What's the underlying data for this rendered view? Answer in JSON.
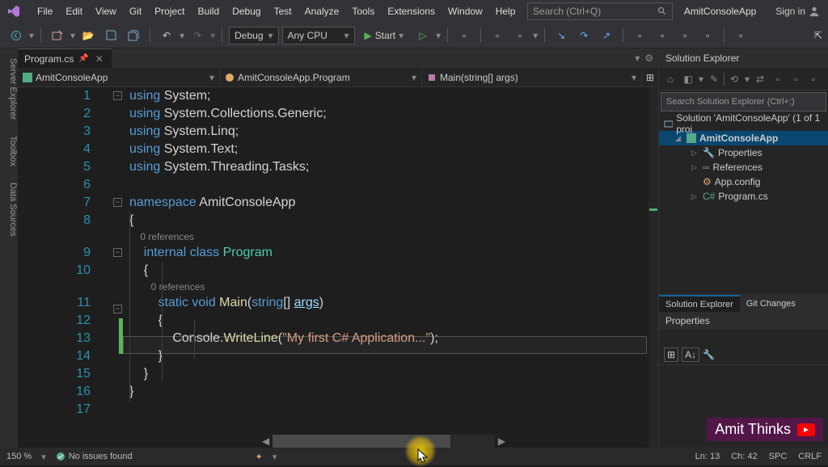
{
  "menubar": [
    "File",
    "Edit",
    "View",
    "Git",
    "Project",
    "Build",
    "Debug",
    "Test",
    "Analyze",
    "Tools",
    "Extensions",
    "Window",
    "Help"
  ],
  "search_placeholder": "Search (Ctrl+Q)",
  "app_title": "AmitConsoleApp",
  "signin": "Sign in",
  "toolbar": {
    "config": "Debug",
    "platform": "Any CPU",
    "start": "Start"
  },
  "tab": {
    "name": "Program.cs"
  },
  "navbar": {
    "project": "AmitConsoleApp",
    "class": "AmitConsoleApp.Program",
    "member": "Main(string[] args)"
  },
  "code": {
    "l1": "using System;",
    "l2": "using System.Collections.Generic;",
    "l3": "using System.Linq;",
    "l4": "using System.Text;",
    "l5": "using System.Threading.Tasks;",
    "ref1": "0 references",
    "ref2": "0 references",
    "l7a": "namespace",
    "l7b": "AmitConsoleApp",
    "l9a": "internal",
    "l9b": "class",
    "l9c": "Program",
    "l11a": "static",
    "l11b": "void",
    "l11c": "Main",
    "l11d": "string",
    "l11e": "args",
    "l13a": "Console",
    "l13b": ".",
    "l13c": "WriteLine",
    "l13d": "\"My first C# Application...\""
  },
  "lines": [
    "1",
    "2",
    "3",
    "4",
    "5",
    "6",
    "7",
    "8",
    "",
    "9",
    "10",
    "",
    "11",
    "12",
    "13",
    "14",
    "15",
    "16",
    "17"
  ],
  "solution": {
    "header": "Solution Explorer",
    "search": "Search Solution Explorer (Ctrl+;)",
    "root": "Solution 'AmitConsoleApp' (1 of 1 proj",
    "project": "AmitConsoleApp",
    "items": [
      "Properties",
      "References",
      "App.config",
      "Program.cs"
    ]
  },
  "panel_tabs": [
    "Solution Explorer",
    "Git Changes"
  ],
  "properties_header": "Properties",
  "status": {
    "zoom": "150 %",
    "issues": "No issues found",
    "ln": "Ln: 13",
    "ch": "Ch: 42",
    "ins": "SPC",
    "crlf": "CRLF"
  },
  "rail": [
    "Server Explorer",
    "Toolbox",
    "Data Sources"
  ],
  "watermark": "Amit Thinks"
}
